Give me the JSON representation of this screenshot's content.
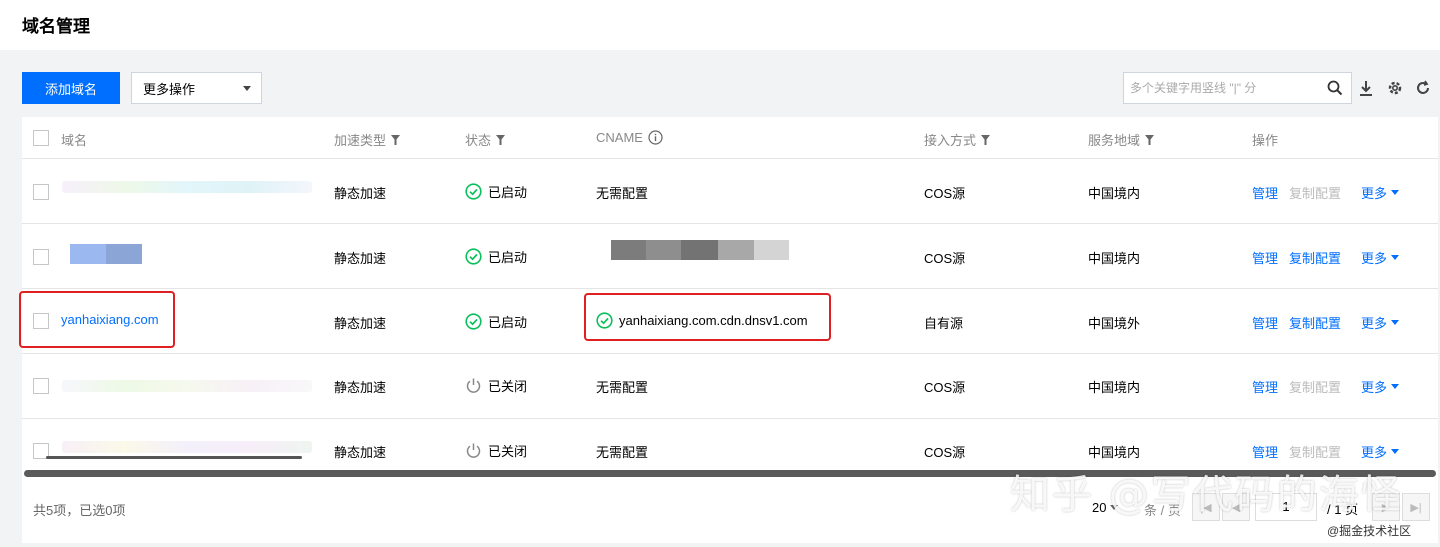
{
  "page": {
    "title": "域名管理"
  },
  "toolbar": {
    "add_label": "添加域名",
    "more_ops_label": "更多操作",
    "search_placeholder": "多个关键字用竖线 \"|\" 分"
  },
  "icons": {
    "search": "search-icon",
    "download": "download-icon",
    "settings": "gear-icon",
    "refresh": "refresh-icon"
  },
  "table": {
    "headers": {
      "domain": "域名",
      "accel_type": "加速类型",
      "status": "状态",
      "cname": "CNAME",
      "access": "接入方式",
      "region": "服务地域",
      "ops": "操作"
    },
    "rows": [
      {
        "domain": "",
        "accel_type": "静态加速",
        "status": "已启动",
        "status_kind": "running",
        "cname": "无需配置",
        "access": "COS源",
        "region": "中国境内",
        "op_manage": "管理",
        "op_copy": "复制配置",
        "op_copy_enabled": false,
        "op_more": "更多"
      },
      {
        "domain": "",
        "accel_type": "静态加速",
        "status": "已启动",
        "status_kind": "running",
        "cname": "",
        "access": "COS源",
        "region": "中国境内",
        "op_manage": "管理",
        "op_copy": "复制配置",
        "op_copy_enabled": true,
        "op_more": "更多"
      },
      {
        "domain": "yanhaixiang.com",
        "accel_type": "静态加速",
        "status": "已启动",
        "status_kind": "running",
        "cname": "yanhaixiang.com.cdn.dnsv1.com",
        "access": "自有源",
        "region": "中国境外",
        "op_manage": "管理",
        "op_copy": "复制配置",
        "op_copy_enabled": true,
        "op_more": "更多"
      },
      {
        "domain": "",
        "accel_type": "静态加速",
        "status": "已关闭",
        "status_kind": "stopped",
        "cname": "无需配置",
        "access": "COS源",
        "region": "中国境内",
        "op_manage": "管理",
        "op_copy": "复制配置",
        "op_copy_enabled": false,
        "op_more": "更多"
      },
      {
        "domain": "",
        "accel_type": "静态加速",
        "status": "已关闭",
        "status_kind": "stopped",
        "cname": "无需配置",
        "access": "COS源",
        "region": "中国境内",
        "op_manage": "管理",
        "op_copy": "复制配置",
        "op_copy_enabled": false,
        "op_more": "更多"
      }
    ]
  },
  "footer": {
    "total": "共5项，已选0项",
    "page_size": "20",
    "per_page": "条 / 页",
    "current_page": "1",
    "of_pages": "/ 1 页"
  },
  "watermark": {
    "main": "知乎 @写代码的海怪",
    "sub": "@掘金技术社区"
  },
  "colors": {
    "accent": "#006eff",
    "success": "#0abf5b",
    "highlight": "#e02020"
  }
}
